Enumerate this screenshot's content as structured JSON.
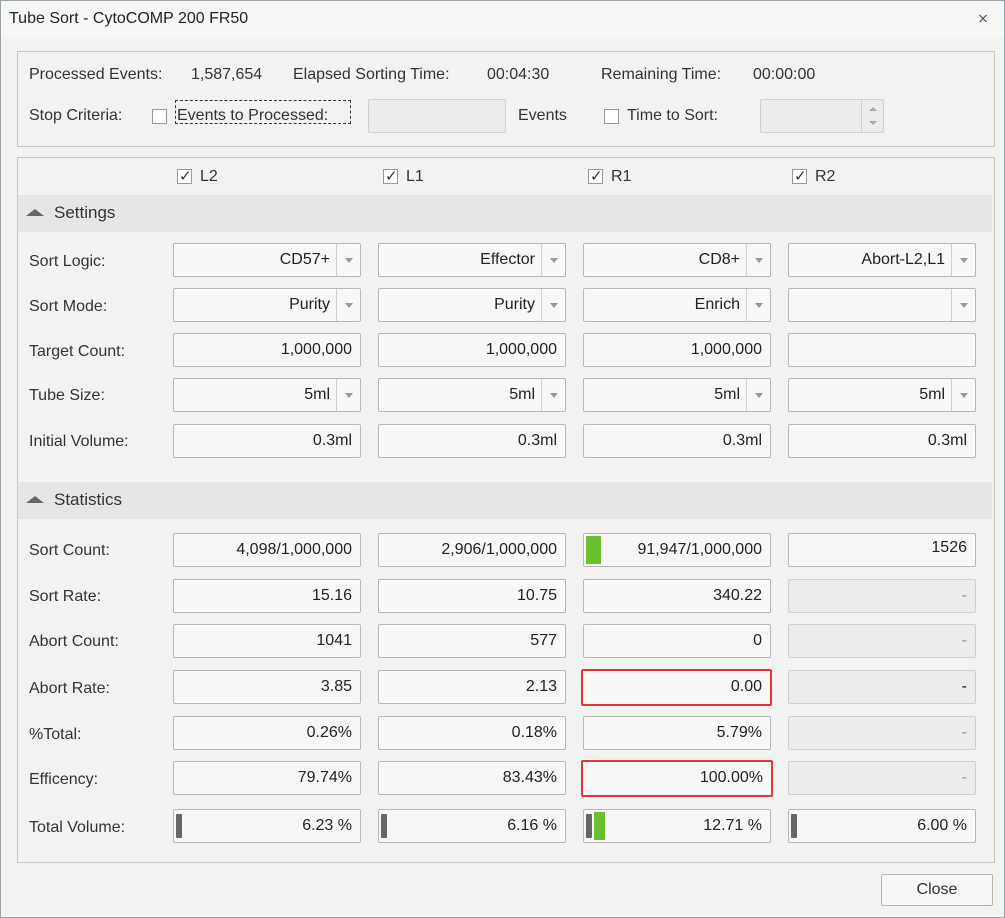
{
  "window": {
    "title": "Tube Sort - CytoCOMP 200 FR50",
    "close_glyph": "⨯"
  },
  "status": {
    "processed_label": "Processed Events:",
    "processed_value": "1,587,654",
    "elapsed_label": "Elapsed Sorting Time:",
    "elapsed_value": "00:04:30",
    "remaining_label": "Remaining Time:",
    "remaining_value": "00:00:00"
  },
  "stop_criteria": {
    "label": "Stop Criteria:",
    "events_label": "Events to Processed:",
    "events_checked": false,
    "events_value": "",
    "events_unit": "Events",
    "time_label": "Time to Sort:",
    "time_checked": false,
    "time_value": ""
  },
  "columns": [
    {
      "name": "L2",
      "checked": true
    },
    {
      "name": "L1",
      "checked": true
    },
    {
      "name": "R1",
      "checked": true
    },
    {
      "name": "R2",
      "checked": true
    }
  ],
  "settings": {
    "title": "Settings",
    "rows": [
      {
        "label": "Sort Logic:",
        "values": [
          "CD57+",
          "Effector",
          "CD8+",
          "Abort-L2,L1"
        ]
      },
      {
        "label": "Sort Mode:",
        "values": [
          "Purity",
          "Purity",
          "Enrich",
          ""
        ]
      },
      {
        "label": "Target Count:",
        "values": [
          "1,000,000",
          "1,000,000",
          "1,000,000",
          ""
        ]
      },
      {
        "label": "Tube Size:",
        "values": [
          "5ml",
          "5ml",
          "5ml",
          "5ml"
        ]
      },
      {
        "label": "Initial Volume:",
        "values": [
          "0.3ml",
          "0.3ml",
          "0.3ml",
          "0.3ml"
        ]
      }
    ]
  },
  "statistics": {
    "title": "Statistics",
    "rows": [
      {
        "label": "Sort Count:",
        "values": [
          "4,098/1,000,000",
          "2,906/1,000,000",
          "91,947/1,000,000",
          "1526"
        ]
      },
      {
        "label": "Sort Rate:",
        "values": [
          "15.16",
          "10.75",
          "340.22",
          "-"
        ]
      },
      {
        "label": "Abort Count:",
        "values": [
          "1041",
          "577",
          "0",
          "-"
        ]
      },
      {
        "label": "Abort Rate:",
        "values": [
          "3.85",
          "2.13",
          "0.00",
          "-"
        ]
      },
      {
        "label": "%Total:",
        "values": [
          "0.26%",
          "0.18%",
          "5.79%",
          "-"
        ]
      },
      {
        "label": "Efficency:",
        "values": [
          "79.74%",
          "83.43%",
          "100.00%",
          "-"
        ]
      },
      {
        "label": "Total Volume:",
        "values": [
          "6.23 %",
          "6.16 %",
          "12.71 %",
          "6.00 %"
        ]
      }
    ],
    "sort_count_progress": [
      0.004098,
      0.002906,
      0.091947,
      0
    ],
    "total_volume_progress": [
      0.0623,
      0.0616,
      0.1271,
      0.06
    ]
  },
  "highlight_color": "#e0353b",
  "progress_color": "#6cbf2f",
  "buttons": {
    "close_label": "Close"
  }
}
